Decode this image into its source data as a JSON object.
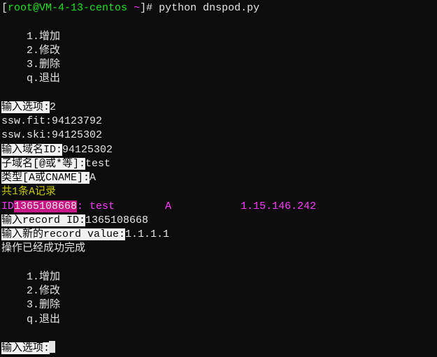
{
  "prompt": {
    "open": "[",
    "user_host": "root@VM-4-13-centos",
    "sep": " ",
    "cwd": "~",
    "close": "]# ",
    "command": "python dnspod.py"
  },
  "menu1": [
    "1.增加",
    "2.修改",
    "3.删除",
    "q.退出"
  ],
  "opt_label": "输入选项:",
  "opt_value": "2",
  "domains": [
    {
      "text": "ssw.fit:94123792"
    },
    {
      "text": "ssw.ski:94125302"
    }
  ],
  "domain_id_label": "输入域名ID:",
  "domain_id_value": "94125302",
  "sub_label": "子域名[@或*等]:",
  "sub_value": "test",
  "type_label": "类型[A或CNAME]:",
  "type_value": "A",
  "count_line": "共1条A记录",
  "record": {
    "id_label": "ID",
    "id_value": "1365108668",
    "colon": ": ",
    "name": "test",
    "type": "A",
    "ip": "1.15.146.242"
  },
  "recid_label": "输入record ID:",
  "recid_value": "1365108668",
  "recval_label": "输入新的record value:",
  "recval_value": "1.1.1.1",
  "success": "操作已经成功完成",
  "menu2": [
    "1.增加",
    "2.修改",
    "3.删除",
    "q.退出"
  ],
  "opt2_label": "输入选项:"
}
